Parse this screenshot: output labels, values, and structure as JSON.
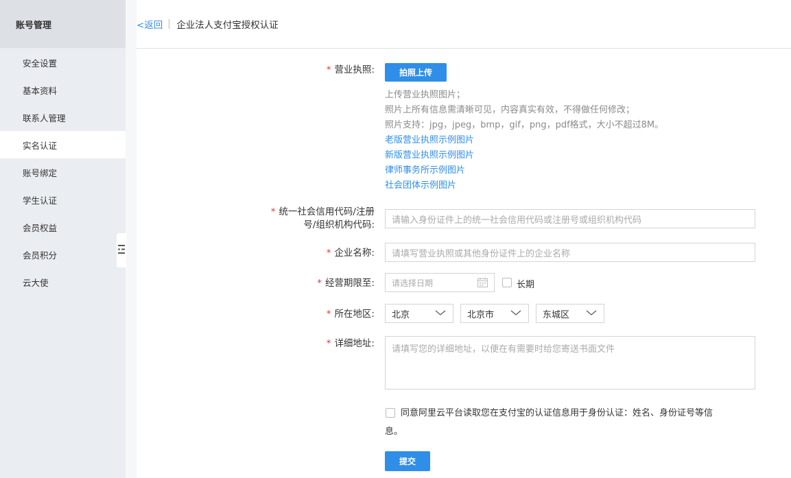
{
  "sidebar": {
    "header": "账号管理",
    "items": [
      {
        "label": "安全设置"
      },
      {
        "label": "基本资料"
      },
      {
        "label": "联系人管理"
      },
      {
        "label": "实名认证",
        "active": true
      },
      {
        "label": "账号绑定"
      },
      {
        "label": "学生认证"
      },
      {
        "label": "会员权益"
      },
      {
        "label": "会员积分"
      },
      {
        "label": "云大使"
      }
    ],
    "toggle_icon": "collapse-icon"
  },
  "header": {
    "back_label": "<返回",
    "title": "企业法人支付宝授权认证"
  },
  "form": {
    "required_mark": "*",
    "license": {
      "label": "营业执照:",
      "upload_button": "拍照上传",
      "hints": [
        "上传营业执照图片；",
        "照片上所有信息需清晰可见，内容真实有效，不得做任何修改；",
        "照片支持：jpg，jpeg，bmp，gif，png，pdf格式，大小不超过8M。"
      ],
      "examples": [
        "老版营业执照示例图片",
        "新版营业执照示例图片",
        "律师事务所示例图片",
        "社会团体示例图片"
      ]
    },
    "credit_code": {
      "label_line1": "统一社会信用代码/注册",
      "label_line2": "号/组织机构代码:",
      "placeholder": "请输入身份证件上的统一社会信用代码或注册号或组织机构代码"
    },
    "company_name": {
      "label": "企业名称:",
      "placeholder": "请填写营业执照或其他身份证件上的企业名称"
    },
    "term": {
      "label": "经营期限至:",
      "placeholder": "请选择日期",
      "long_term_label": "长期"
    },
    "region": {
      "label": "所在地区:",
      "province": "北京",
      "city": "北京市",
      "district": "东城区"
    },
    "address": {
      "label": "详细地址:",
      "placeholder": "请填写您的详细地址，以便在有需要时给您寄送书面文件"
    },
    "agreement": {
      "line1": "同意阿里云平台读取您在支付宝的认证信息用于身份认证：姓名、身份证号等信",
      "line2": "息。"
    },
    "submit_label": "提交"
  }
}
